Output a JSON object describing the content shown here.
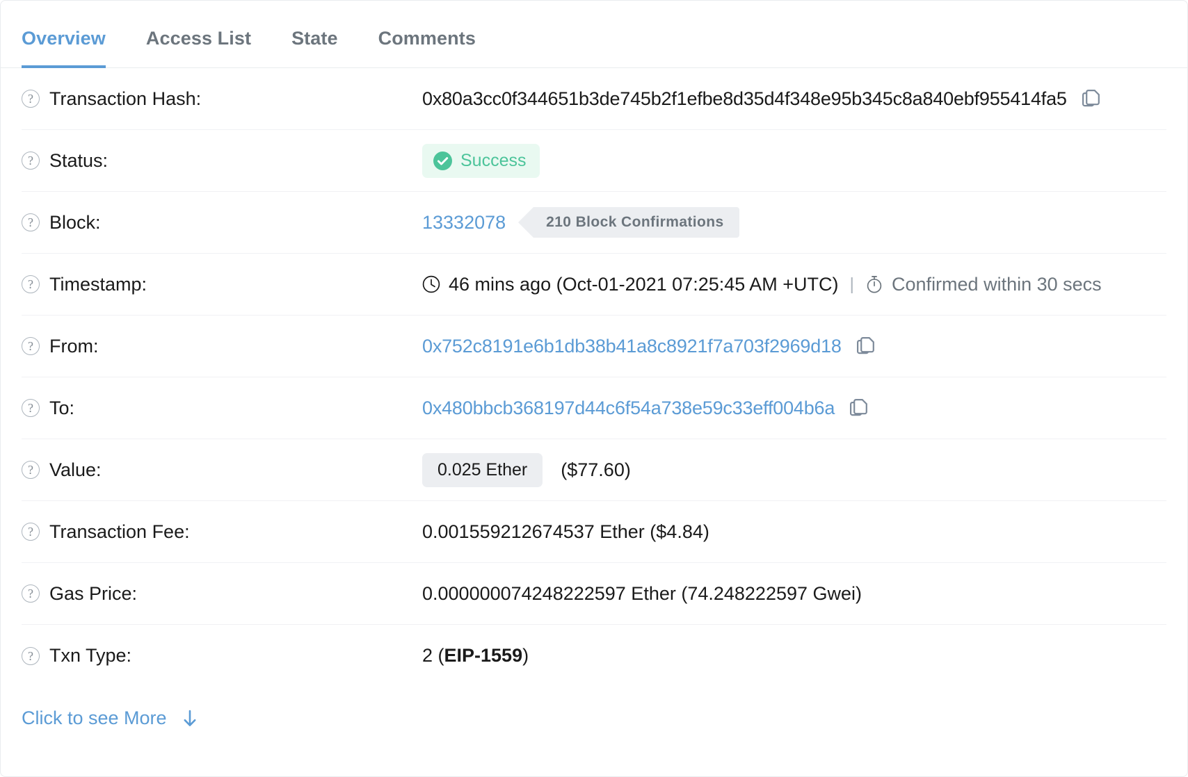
{
  "tabs": [
    {
      "label": "Overview",
      "active": true
    },
    {
      "label": "Access List",
      "active": false
    },
    {
      "label": "State",
      "active": false
    },
    {
      "label": "Comments",
      "active": false
    }
  ],
  "rows": {
    "transaction_hash": {
      "label": "Transaction Hash:",
      "value": "0x80a3cc0f344651b3de745b2f1efbe8d35d4f348e95b345c8a840ebf955414fa5",
      "copy_icon": "copy-icon"
    },
    "status": {
      "label": "Status:",
      "value": "Success",
      "icon": "check-circle-icon",
      "badge_bg": "#e9f9f1",
      "badge_color": "#4cc49a"
    },
    "block": {
      "label": "Block:",
      "number": "13332078",
      "confirmations": "210 Block Confirmations"
    },
    "timestamp": {
      "label": "Timestamp:",
      "relative": "46 mins ago (Oct-01-2021 07:25:45 AM +UTC)",
      "separator": "|",
      "confirmed": "Confirmed within 30 secs",
      "clock_icon": "clock-icon",
      "stopwatch_icon": "stopwatch-icon"
    },
    "from": {
      "label": "From:",
      "address": "0x752c8191e6b1db38b41a8c8921f7a703f2969d18",
      "copy_icon": "copy-icon"
    },
    "to": {
      "label": "To:",
      "address": "0x480bbcb368197d44c6f54a738e59c33eff004b6a",
      "copy_icon": "copy-icon"
    },
    "value": {
      "label": "Value:",
      "ether": "0.025 Ether",
      "usd": "($77.60)"
    },
    "transaction_fee": {
      "label": "Transaction Fee:",
      "value": "0.001559212674537 Ether ($4.84)"
    },
    "gas_price": {
      "label": "Gas Price:",
      "value": "0.000000074248222597 Ether (74.248222597 Gwei)"
    },
    "txn_type": {
      "label": "Txn Type:",
      "prefix": "2 (",
      "eip": "EIP-1559",
      "suffix": ")"
    }
  },
  "footer": {
    "more_label": "Click to see More",
    "arrow_icon": "arrow-down-icon"
  },
  "colors": {
    "link": "#5b9bd5",
    "success": "#4cc49a",
    "muted": "#6c757d",
    "border": "#f0f1f4"
  }
}
